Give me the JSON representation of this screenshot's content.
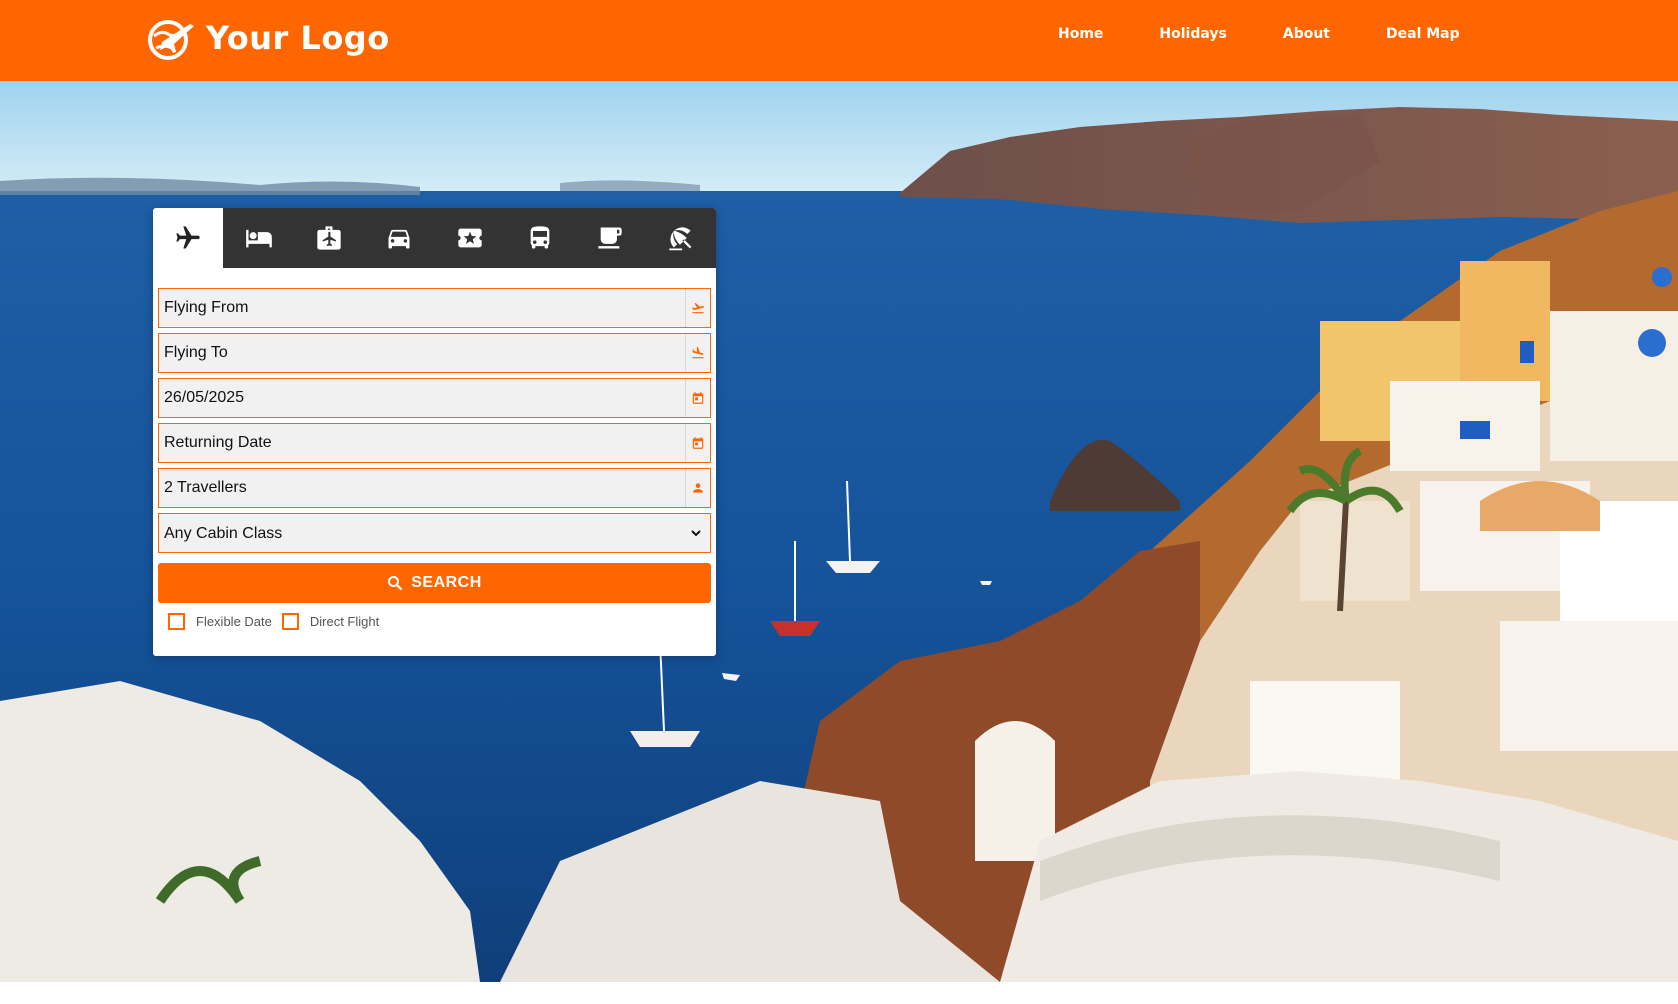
{
  "brand": {
    "logo_text": "Your Logo",
    "accent": "#ff6600",
    "tab_bar_bg": "#333333"
  },
  "nav": {
    "items": [
      "Home",
      "Holidays",
      "About",
      "Deal Map"
    ]
  },
  "search": {
    "tabs": [
      {
        "name": "flights",
        "icon": "airplane-icon",
        "active": true
      },
      {
        "name": "hotels",
        "icon": "bed-icon",
        "active": false
      },
      {
        "name": "flight-hotel",
        "icon": "luggage-airplane-icon",
        "active": false
      },
      {
        "name": "cars",
        "icon": "car-icon",
        "active": false
      },
      {
        "name": "activities",
        "icon": "ticket-star-icon",
        "active": false
      },
      {
        "name": "transfers",
        "icon": "bus-icon",
        "active": false
      },
      {
        "name": "cafes",
        "icon": "coffee-cup-icon",
        "active": false
      },
      {
        "name": "beach-holidays",
        "icon": "beach-icon",
        "active": false
      }
    ],
    "flying_from": {
      "placeholder": "Flying From",
      "value": ""
    },
    "flying_to": {
      "placeholder": "Flying To",
      "value": ""
    },
    "depart_date": {
      "value": "26/05/2025"
    },
    "return_date": {
      "placeholder": "Returning Date",
      "value": ""
    },
    "travellers": {
      "value": "2 Travellers"
    },
    "cabin_class": {
      "selected": "Any Cabin Class"
    },
    "search_label": "SEARCH",
    "flexible_date_label": "Flexible Date",
    "direct_flight_label": "Direct Flight"
  }
}
